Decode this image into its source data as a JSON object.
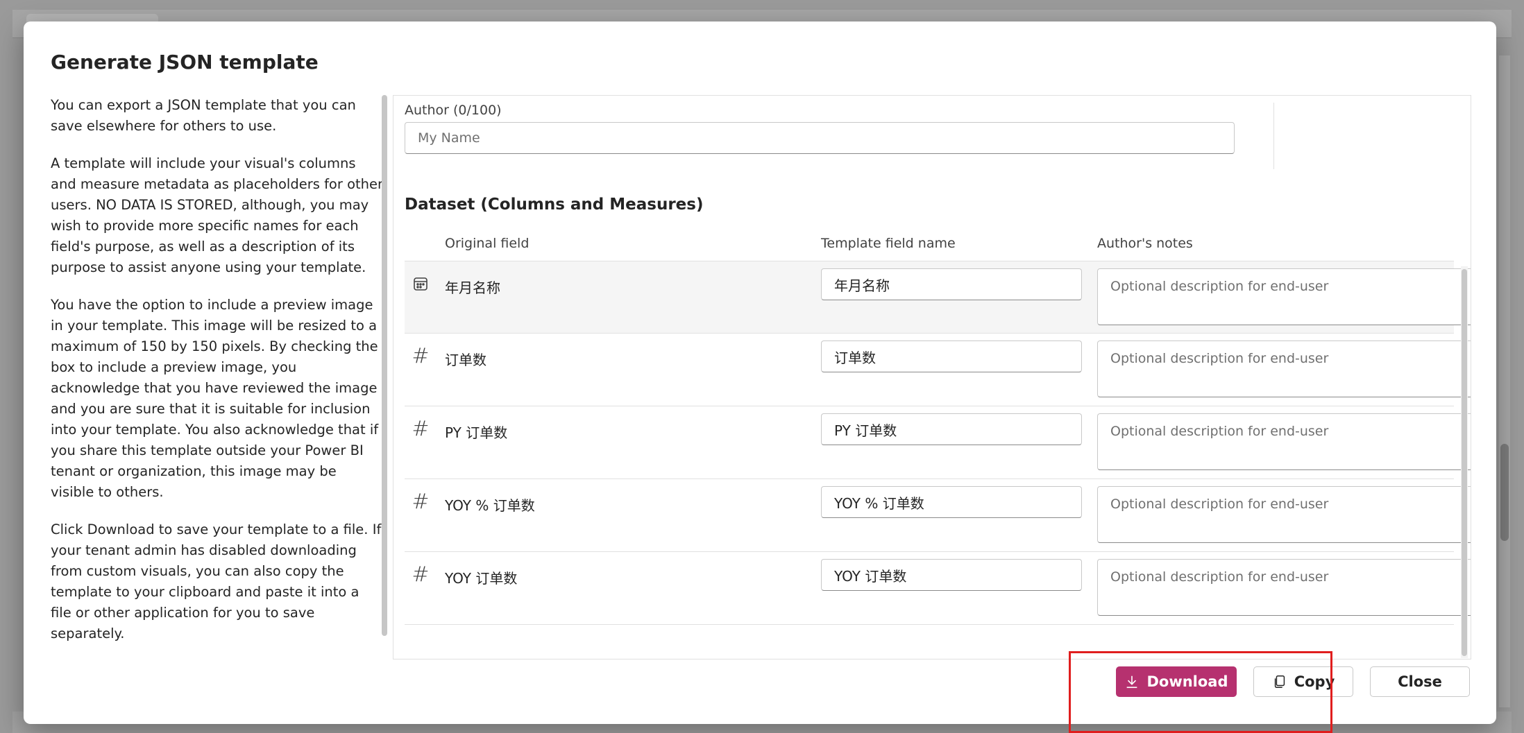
{
  "dialog": {
    "title": "Generate JSON template",
    "help_paragraphs": [
      "You can export a JSON template that you can save elsewhere for others to use.",
      "A template will include your visual's columns and measure metadata as placeholders for other users. NO DATA IS STORED, although, you may wish to provide more specific names for each field's purpose, as well as a description of its purpose to assist anyone using your template.",
      "You have the option to include a preview image in your template. This image will be resized to a maximum of 150 by 150 pixels. By checking the box to include a preview image, you acknowledge that you have reviewed the image and you are sure that it is suitable for inclusion into your template. You also acknowledge that if you share this template outside your Power BI tenant or organization, this image may be visible to others.",
      "Click Download to save your template to a file. If your tenant admin has disabled downloading from custom visuals, you can also copy the template to your clipboard and paste it into a file or other application for you to save separately."
    ],
    "author": {
      "label": "Author (0/100)",
      "placeholder": "My Name",
      "value": ""
    },
    "dataset": {
      "title": "Dataset (Columns and Measures)",
      "columns": {
        "original": "Original field",
        "template": "Template field name",
        "notes": "Author's notes"
      },
      "rows": [
        {
          "icon": "calendar-icon",
          "original": "年月名称",
          "template": "年月名称",
          "notes_placeholder": "Optional description for end-user"
        },
        {
          "icon": "hash-icon",
          "original": "订单数",
          "template": "订单数",
          "notes_placeholder": "Optional description for end-user"
        },
        {
          "icon": "hash-icon",
          "original": "PY 订单数",
          "template": "PY 订单数",
          "notes_placeholder": "Optional description for end-user"
        },
        {
          "icon": "hash-icon",
          "original": "YOY % 订单数",
          "template": "YOY % 订单数",
          "notes_placeholder": "Optional description for end-user"
        },
        {
          "icon": "hash-icon",
          "original": "YOY 订单数",
          "template": "YOY 订单数",
          "notes_placeholder": "Optional description for end-user"
        }
      ]
    },
    "buttons": {
      "download": "Download",
      "copy": "Copy",
      "close": "Close"
    }
  },
  "colors": {
    "accent": "#b6316f",
    "highlight": "#e01e1e"
  }
}
